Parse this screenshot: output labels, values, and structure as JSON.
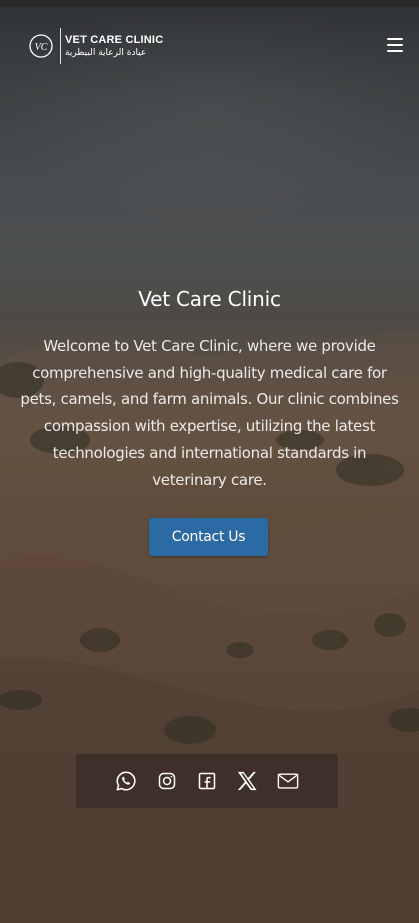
{
  "header": {
    "logo": {
      "name_en": "VET CARE CLINIC",
      "name_ar": "عيادة الرعاية البيطرية",
      "mark": "VC"
    },
    "menu_icon": "hamburger-menu-icon"
  },
  "hero": {
    "title": "Vet Care Clinic",
    "description": "Welcome to Vet Care Clinic, where we provide comprehensive and high-quality medical care for pets, camels, and farm animals. Our clinic combines compassion with expertise, utilizing the latest technologies and international standards in veterinary care.",
    "cta_label": "Contact Us"
  },
  "social": [
    {
      "icon": "whatsapp-icon"
    },
    {
      "icon": "instagram-icon"
    },
    {
      "icon": "facebook-icon"
    },
    {
      "icon": "x-twitter-icon"
    },
    {
      "icon": "mail-icon"
    }
  ],
  "colors": {
    "primary_button": "#2b6aa3",
    "text": "#ffffff"
  }
}
